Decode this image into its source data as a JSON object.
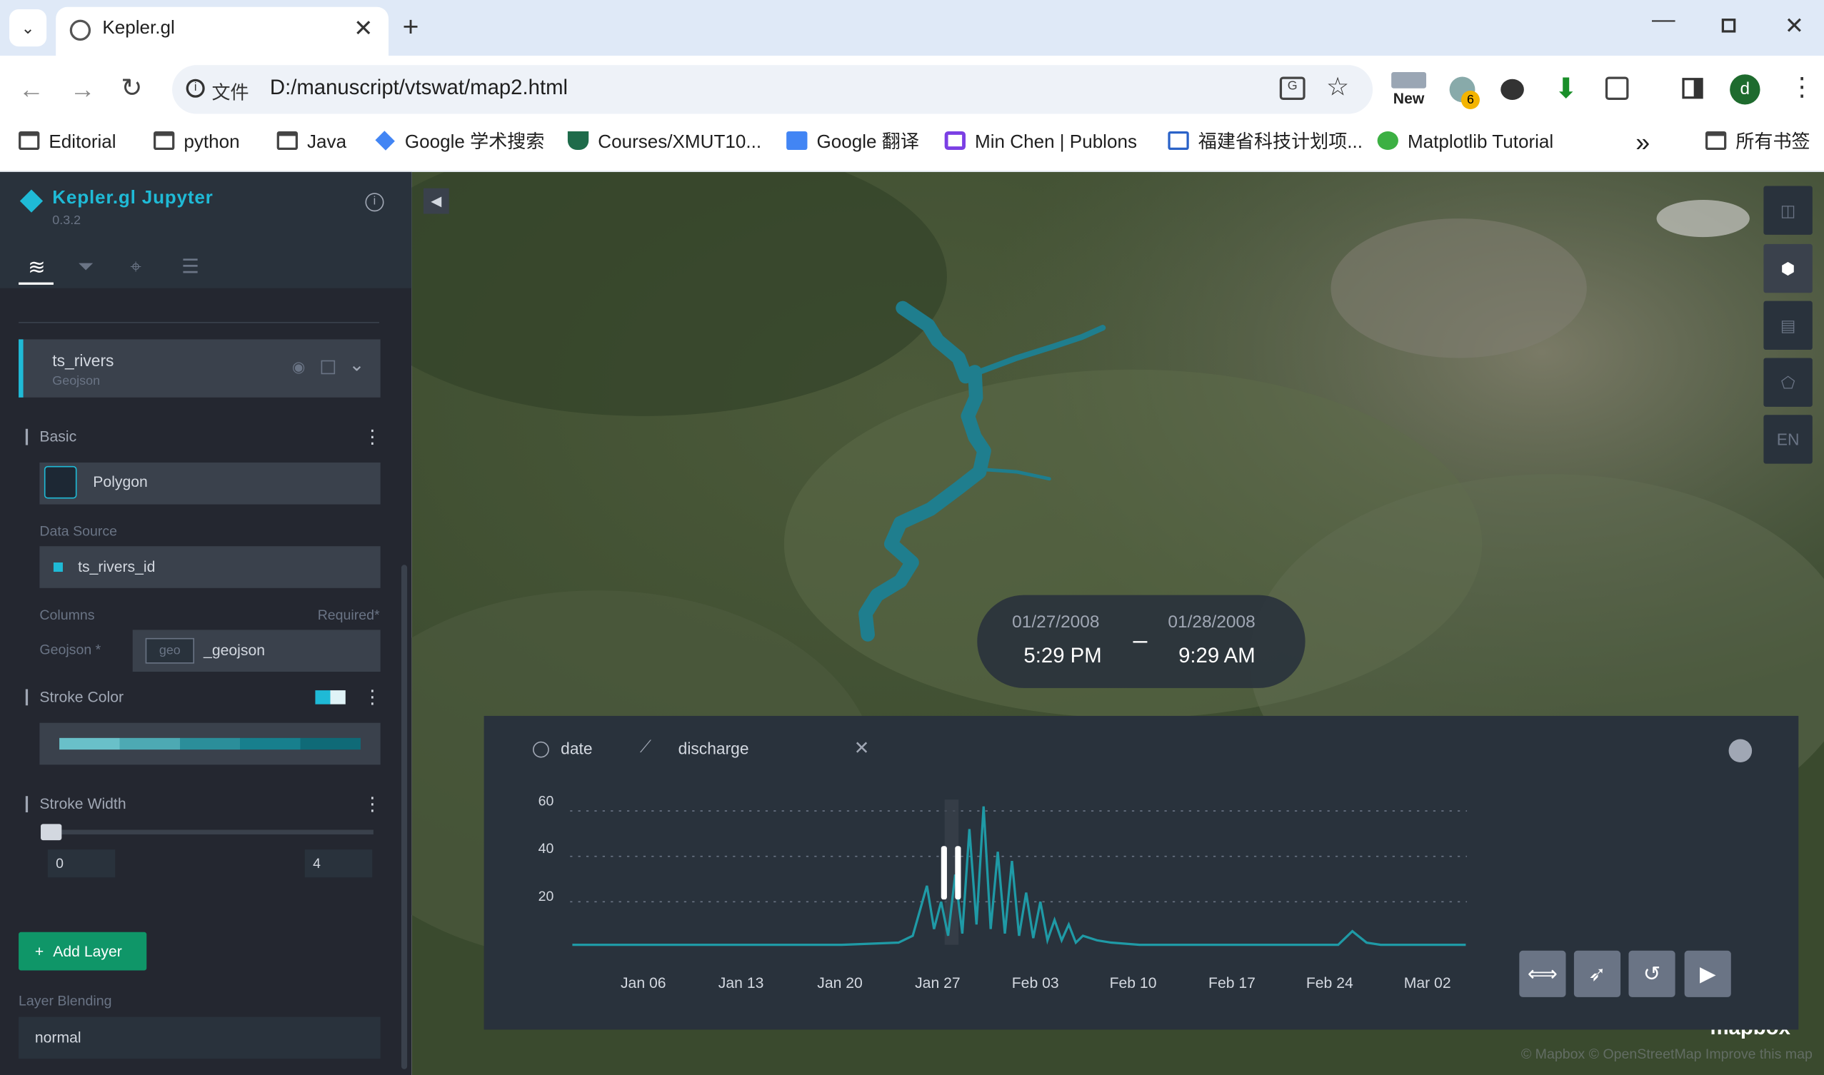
{
  "browser": {
    "tab_title": "Kepler.gl",
    "url_label": "文件",
    "url": "D:/manuscript/vtswat/map2.html",
    "new_badge": "New",
    "extension_count": "6",
    "profile_initial": "d",
    "bookmarks": [
      {
        "label": "Editorial"
      },
      {
        "label": "python"
      },
      {
        "label": "Java"
      },
      {
        "label": "Google 学术搜索"
      },
      {
        "label": "Courses/XMUT10..."
      },
      {
        "label": "Google 翻译"
      },
      {
        "label": "Min Chen | Publons"
      },
      {
        "label": "福建省科技计划项..."
      },
      {
        "label": "Matplotlib Tutorial"
      }
    ],
    "more_bookmarks": "»",
    "all_bookmarks": "所有书签"
  },
  "panel": {
    "app_title": "Kepler.gl Jupyter",
    "version": "0.3.2",
    "layer_name": "ts_rivers",
    "layer_type": "Geojson",
    "basic_label": "Basic",
    "layer_kind": "Polygon",
    "data_source_label": "Data Source",
    "data_source_value": "ts_rivers_id",
    "columns_label": "Columns",
    "required_label": "Required*",
    "geojson_label": "Geojson *",
    "geo_tag": "geo",
    "geojson_value": "_geojson",
    "stroke_color_label": "Stroke Color",
    "stroke_width_label": "Stroke Width",
    "stroke_width_min": "0",
    "stroke_width_max": "4",
    "add_layer": "Add Layer",
    "blending_label": "Layer Blending",
    "blending_value": "normal",
    "colors": {
      "accent": "#1fbad6",
      "button": "#0f9668",
      "panel": "#242730"
    }
  },
  "map": {
    "time_start_date": "01/27/2008",
    "time_start_time": "5:29 PM",
    "time_end_date": "01/28/2008",
    "time_end_time": "9:29 AM",
    "time_separator": "–",
    "lang": "EN",
    "attribution": "© Mapbox © OpenStreetMap Improve this map",
    "logo": "mapbox"
  },
  "timeline": {
    "x_field": "date",
    "y_field": "discharge"
  },
  "chart_data": {
    "type": "line",
    "title": "",
    "xlabel": "date",
    "ylabel": "discharge",
    "ylim": [
      0,
      65
    ],
    "y_ticks": [
      "60",
      "40",
      "20"
    ],
    "x_ticks": [
      "Jan 06",
      "Jan 13",
      "Jan 20",
      "Jan 27",
      "Feb 03",
      "Feb 10",
      "Feb 17",
      "Feb 24",
      "Mar 02"
    ],
    "series": [
      {
        "color": "#1f9aa6",
        "x": [
          "Jan 01",
          "Jan 05",
          "Jan 10",
          "Jan 15",
          "Jan 20",
          "Jan 24",
          "Jan 25",
          "Jan 26",
          "Jan 26",
          "Jan 27",
          "Jan 27",
          "Jan 28",
          "Jan 28",
          "Jan 29",
          "Jan 29",
          "Jan 30",
          "Jan 30",
          "Jan 31",
          "Jan 31",
          "Feb 01",
          "Feb 01",
          "Feb 02",
          "Feb 02",
          "Feb 03",
          "Feb 03",
          "Feb 04",
          "Feb 04",
          "Feb 05",
          "Feb 05",
          "Feb 06",
          "Feb 07",
          "Feb 08",
          "Feb 10",
          "Feb 15",
          "Feb 20",
          "Feb 24",
          "Feb 25",
          "Feb 26",
          "Feb 27",
          "Mar 01",
          "Mar 04"
        ],
        "y": [
          1,
          1,
          1,
          1,
          1,
          2,
          5,
          27,
          8,
          20,
          5,
          32,
          6,
          52,
          10,
          62,
          8,
          42,
          6,
          38,
          5,
          24,
          4,
          20,
          3,
          12,
          3,
          10,
          2,
          5,
          3,
          2,
          1,
          1,
          1,
          1,
          7,
          2,
          1,
          1,
          1
        ]
      }
    ],
    "grid": true,
    "legend": "none"
  }
}
